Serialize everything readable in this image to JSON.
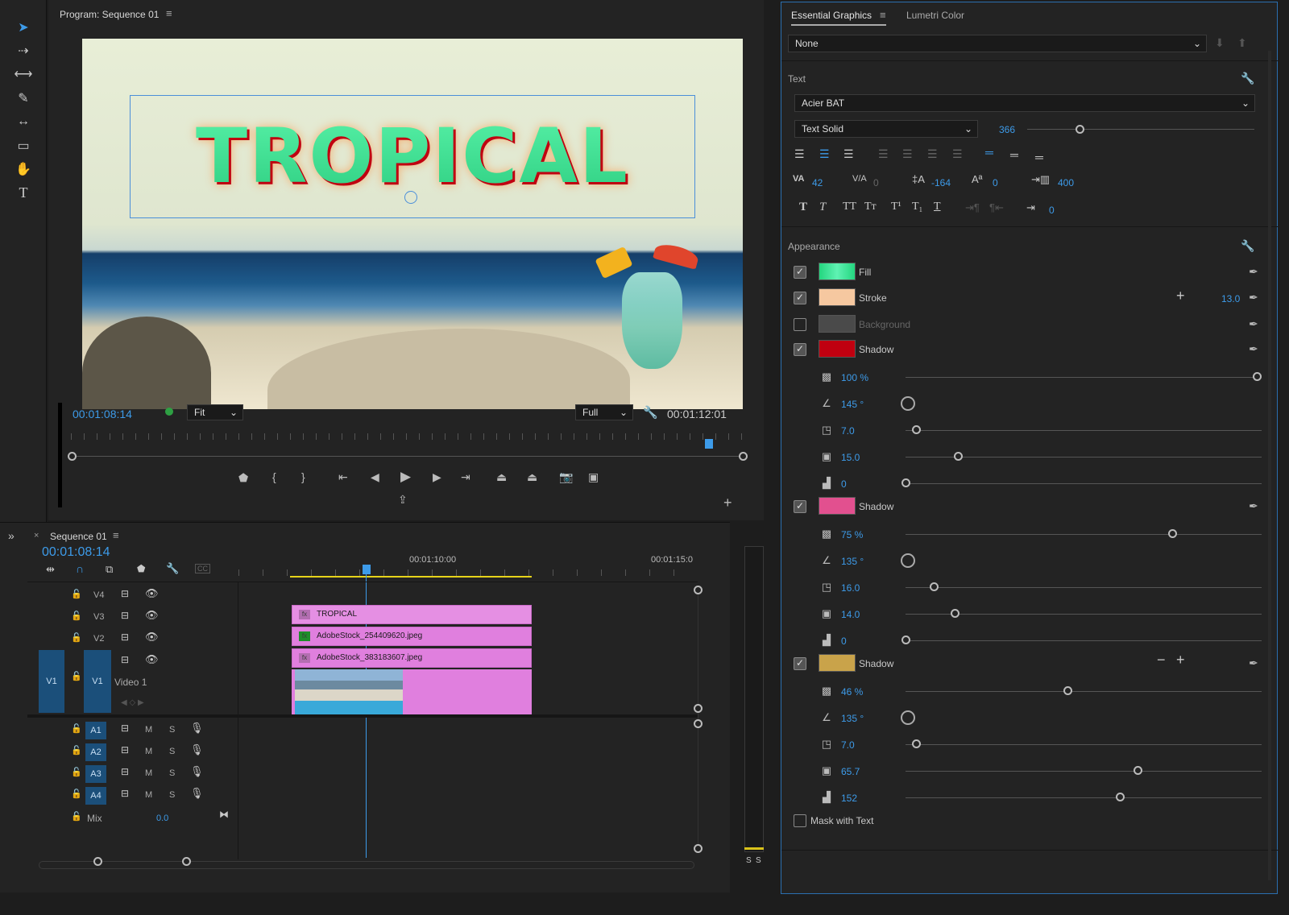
{
  "program": {
    "title": "Program: Sequence 01",
    "title_text": "TROPICAL",
    "timecode": "00:01:08:14",
    "fit": "Fit",
    "resolution": "Full",
    "duration": "00:01:12:01"
  },
  "timeline": {
    "tab": "Sequence 01",
    "timecode": "00:01:08:14",
    "ruler": [
      "00:01:10:00",
      "00:01:15:0"
    ],
    "video_tracks": [
      {
        "id": "V4"
      },
      {
        "id": "V3"
      },
      {
        "id": "V2"
      },
      {
        "id": "V1",
        "name": "Video 1",
        "src": "V1"
      }
    ],
    "audio_tracks": [
      {
        "id": "A1",
        "m": "M",
        "s": "S"
      },
      {
        "id": "A2",
        "m": "M",
        "s": "S"
      },
      {
        "id": "A3",
        "m": "M",
        "s": "S"
      },
      {
        "id": "A4",
        "m": "M",
        "s": "S"
      }
    ],
    "mix": {
      "label": "Mix",
      "value": "0.0"
    },
    "clips": {
      "v3": "TROPICAL",
      "v2": "AdobeStock_254409620.jpeg",
      "v1": "AdobeStock_383183607.jpeg"
    },
    "meters": [
      "S",
      "S"
    ]
  },
  "eg": {
    "tabs": [
      "Essential Graphics",
      "Lumetri Color"
    ],
    "preset": "None",
    "text_section": "Text",
    "font": "Acier BAT",
    "style": "Text Solid",
    "size": "366",
    "size_level": 0.23,
    "kerning": "42",
    "tracking": "0",
    "leading": "-164",
    "baseline": "0",
    "tsume": "400",
    "indent": "0",
    "appearance_section": "Appearance",
    "fill_label": "Fill",
    "stroke_label": "Stroke",
    "stroke_width": "13.0",
    "background_label": "Background",
    "shadows": [
      {
        "label": "Shadow",
        "color": "#c00010",
        "opacity": "100 %",
        "opacity_level": 1.0,
        "angle": "145 °",
        "distance": "7.0",
        "distance_level": 0.03,
        "size": "15.0",
        "size_level": 0.15,
        "blur": "0",
        "blur_level": 0.0
      },
      {
        "label": "Shadow",
        "color": "#e2508f",
        "opacity": "75 %",
        "opacity_level": 0.76,
        "angle": "135 °",
        "distance": "16.0",
        "distance_level": 0.08,
        "size": "14.0",
        "size_level": 0.14,
        "blur": "0",
        "blur_level": 0.0
      },
      {
        "label": "Shadow",
        "color": "#c9a34a",
        "opacity": "46 %",
        "opacity_level": 0.46,
        "angle": "135 °",
        "distance": "7.0",
        "distance_level": 0.03,
        "size": "65.7",
        "size_level": 0.66,
        "blur": "152",
        "blur_level": 0.61
      }
    ],
    "mask_label": "Mask with Text"
  },
  "colors": {
    "accent": "#3d9be9",
    "clip": "#e07fde",
    "fill_top": "#39e89b",
    "stroke": "#f6c8a0"
  }
}
